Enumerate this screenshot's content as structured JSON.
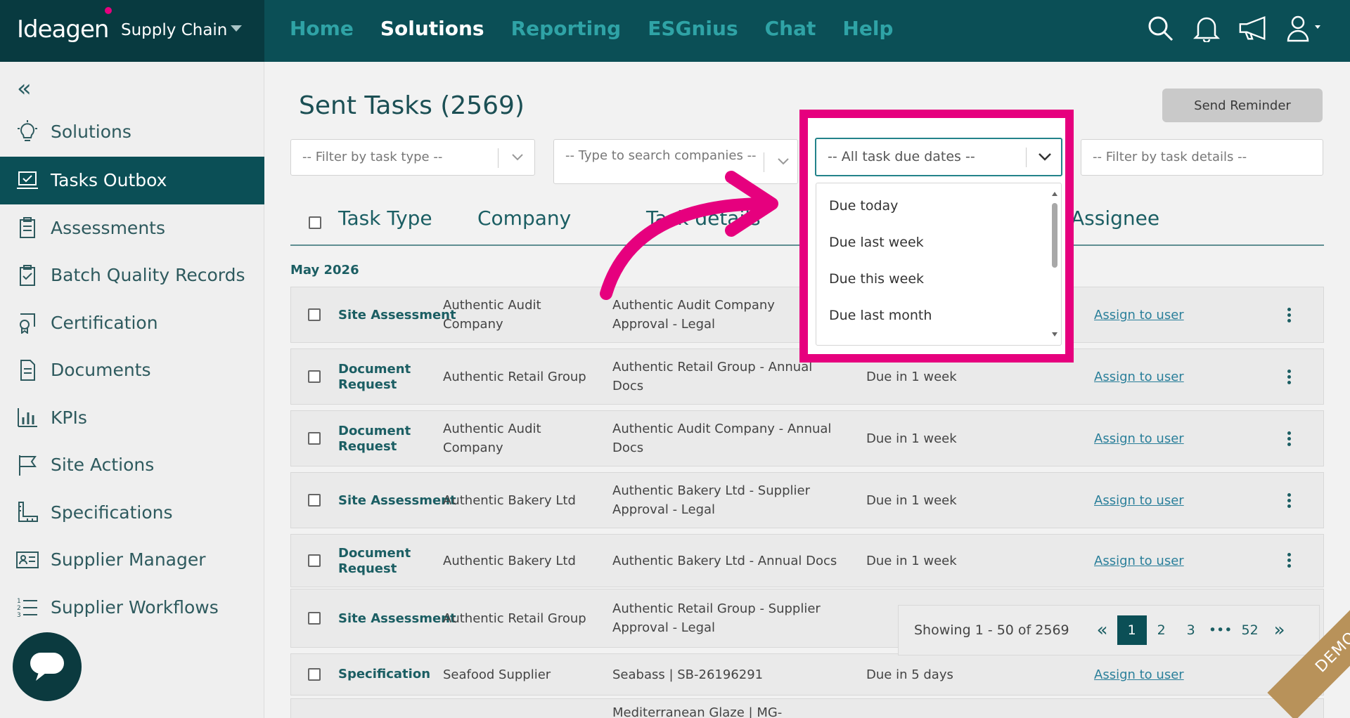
{
  "brand": {
    "logo": "Ideagen",
    "product": "Supply Chain"
  },
  "nav": [
    "Home",
    "Solutions",
    "Reporting",
    "ESGnius",
    "Chat",
    "Help"
  ],
  "nav_active": "Solutions",
  "sidebar": {
    "solutions": "Solutions",
    "items": [
      {
        "label": "Tasks Outbox",
        "icon": "laptop-check-icon",
        "active": true
      },
      {
        "label": "Assessments",
        "icon": "clipboard-list-icon"
      },
      {
        "label": "Batch Quality Records",
        "icon": "clipboard-check-icon"
      },
      {
        "label": "Certification",
        "icon": "certificate-icon"
      },
      {
        "label": "Documents",
        "icon": "document-icon"
      },
      {
        "label": "KPIs",
        "icon": "bar-chart-icon"
      },
      {
        "label": "Site Actions",
        "icon": "flag-icon"
      },
      {
        "label": "Specifications",
        "icon": "ruler-icon"
      },
      {
        "label": "Supplier Manager",
        "icon": "id-card-icon"
      },
      {
        "label": "Supplier Workflows",
        "icon": "numbered-list-icon"
      }
    ]
  },
  "page": {
    "title": "Sent Tasks (2569)",
    "send_reminder": "Send Reminder"
  },
  "filters": {
    "task_type": "-- Filter by task type --",
    "companies": "-- Type to search companies --",
    "due_dates": "-- All task due dates --",
    "task_details": "-- Filter by task details --"
  },
  "table": {
    "headers": {
      "task_type": "Task Type",
      "company": "Company",
      "task_details": "Task details",
      "assignee": "Assignee"
    },
    "month": "May 2026",
    "rows": [
      {
        "type": "Site Assessment",
        "company": "Authentic Audit Company",
        "details": "Authentic Audit Company Approval - Legal",
        "due": "",
        "assignee": "Assign to user"
      },
      {
        "type": "Document Request",
        "company": "Authentic Retail Group",
        "details": "Authentic Retail Group - Annual Docs",
        "due": "Due in 1 week",
        "assignee": "Assign to user"
      },
      {
        "type": "Document Request",
        "company": "Authentic Audit Company",
        "details": "Authentic Audit Company - Annual Docs",
        "due": "Due in 1 week",
        "assignee": "Assign to user"
      },
      {
        "type": "Site Assessment",
        "company": "Authentic Bakery Ltd",
        "details": "Authentic Bakery Ltd - Supplier Approval - Legal",
        "due": "Due in 1 week",
        "assignee": "Assign to user"
      },
      {
        "type": "Document Request",
        "company": "Authentic Bakery Ltd",
        "details": "Authentic Bakery Ltd - Annual Docs",
        "due": "Due in 1 week",
        "assignee": "Assign to user"
      },
      {
        "type": "Site Assessment",
        "company": "Authentic Retail Group",
        "details": "Authentic Retail Group - Supplier Approval - Legal",
        "due": "",
        "assignee": ""
      },
      {
        "type": "Specification",
        "company": "Seafood Supplier",
        "details": "Seabass | SB-26196291",
        "due": "Due in 5 days",
        "assignee": "Assign to user"
      },
      {
        "type": "",
        "company": "",
        "details": "Mediterranean Glaze | MG-",
        "due": "",
        "assignee": ""
      }
    ]
  },
  "pagination": {
    "info": "Showing 1 - 50 of 2569",
    "prev": "«",
    "pages": [
      "1",
      "2",
      "3",
      "•••",
      "52"
    ],
    "next": "»",
    "current": "1"
  },
  "dropdown": {
    "options": [
      "Due today",
      "Due last week",
      "Due this week",
      "Due last month"
    ]
  },
  "ribbon": "DEMO",
  "colors": {
    "primary": "#0b4f56",
    "highlight": "#e6007e",
    "link": "#2a7f9a"
  }
}
